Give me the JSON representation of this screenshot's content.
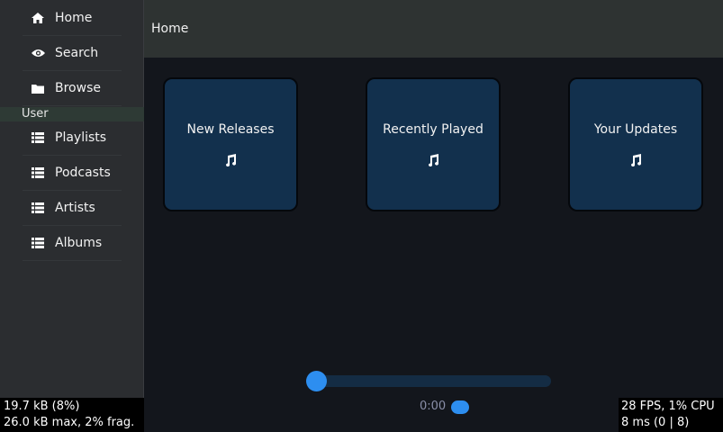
{
  "sidebar": {
    "items": [
      {
        "label": "Home",
        "icon": "home-icon"
      },
      {
        "label": "Search",
        "icon": "eye-icon"
      },
      {
        "label": "Browse",
        "icon": "folder-icon"
      }
    ],
    "section_label": "User",
    "user_items": [
      {
        "label": "Playlists",
        "icon": "list-icon"
      },
      {
        "label": "Podcasts",
        "icon": "list-icon"
      },
      {
        "label": "Artists",
        "icon": "list-icon"
      },
      {
        "label": "Albums",
        "icon": "list-icon"
      }
    ]
  },
  "header": {
    "title": "Home"
  },
  "cards": [
    {
      "label": "New Releases",
      "icon": "music-note-icon"
    },
    {
      "label": "Recently Played",
      "icon": "music-note-icon"
    },
    {
      "label": "Your Updates",
      "icon": "music-note-icon"
    }
  ],
  "player": {
    "time": "0:00",
    "progress": 0
  },
  "debug": {
    "mem_line1": "19.7 kB (8%)",
    "mem_line2": "26.0 kB max, 2% frag.",
    "perf_line1": "28 FPS, 1% CPU",
    "perf_line2": "8 ms (0 | 8)"
  },
  "colors": {
    "accent": "#2d8ef0",
    "card_bg": "#12304d",
    "sidebar_bg": "#2b2d30",
    "header_bg": "#2e3332",
    "content_bg": "#13161c"
  }
}
